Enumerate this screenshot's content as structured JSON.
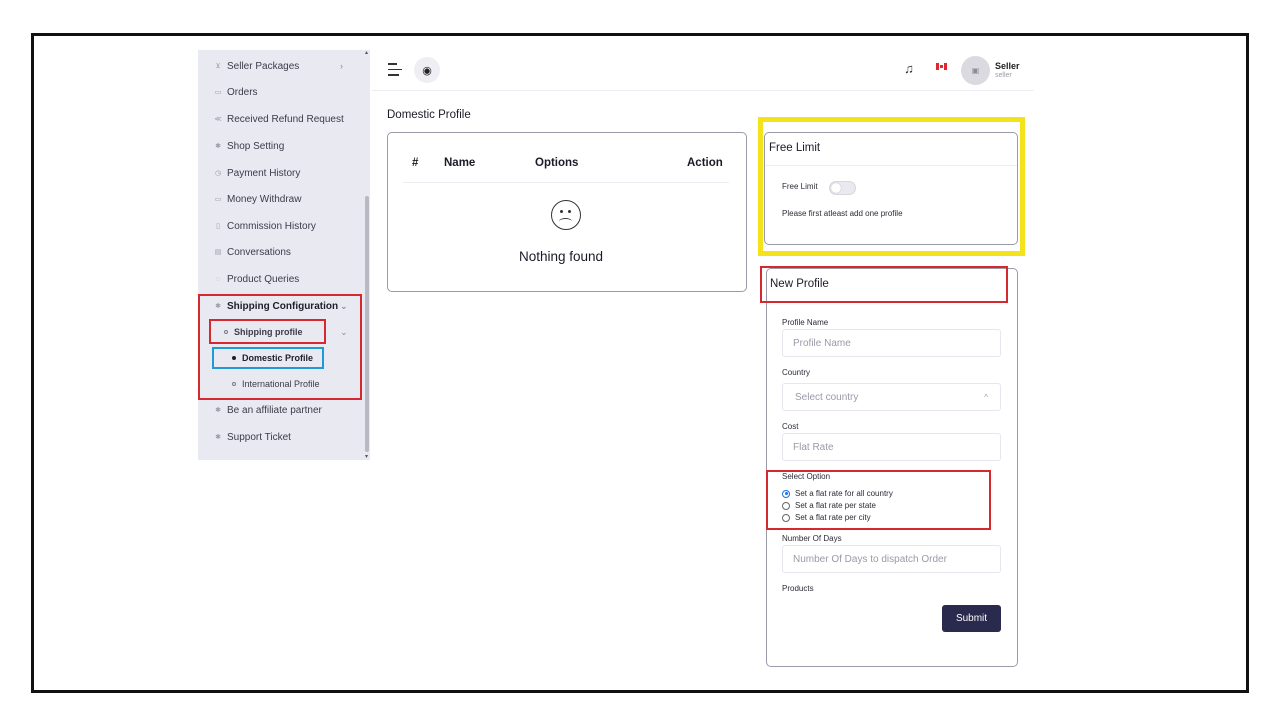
{
  "sidebar": {
    "items": [
      {
        "label": "Seller Packages",
        "icon": "cart-icon"
      },
      {
        "label": "Orders",
        "icon": "orders-icon"
      },
      {
        "label": "Received Refund Request",
        "icon": "refund-icon"
      },
      {
        "label": "Shop Setting",
        "icon": "gear-icon"
      },
      {
        "label": "Payment History",
        "icon": "history-icon"
      },
      {
        "label": "Money Withdraw",
        "icon": "wallet-icon"
      },
      {
        "label": "Commission History",
        "icon": "file-icon"
      },
      {
        "label": "Conversations",
        "icon": "chat-icon"
      },
      {
        "label": "Product Queries",
        "icon": "question-icon"
      },
      {
        "label": "Shipping Configuration",
        "icon": "gear-icon"
      },
      {
        "label": "Be an affiliate partner",
        "icon": "gear-icon"
      },
      {
        "label": "Support Ticket",
        "icon": "gear-icon"
      }
    ],
    "shipping_profile": "Shipping profile",
    "sub_items": [
      "Domestic Profile",
      "International Profile"
    ]
  },
  "header": {
    "user_name": "Seller",
    "user_role": "seller"
  },
  "main": {
    "title": "Domestic Profile",
    "table": {
      "columns": [
        "#",
        "Name",
        "Options",
        "Action"
      ],
      "empty_text": "Nothing found"
    }
  },
  "free_limit": {
    "title": "Free Limit",
    "toggle_label": "Free Limit",
    "note": "Please first atleast add one profile",
    "enabled": false
  },
  "new_profile": {
    "title": "New Profile",
    "profile_name_label": "Profile Name",
    "profile_name_placeholder": "Profile Name",
    "country_label": "Country",
    "country_placeholder": "Select country",
    "cost_label": "Cost",
    "cost_placeholder": "Flat Rate",
    "select_option_label": "Select Option",
    "options": [
      "Set a flat rate for all country",
      "Set a flat rate per state",
      "Set a flat rate per city"
    ],
    "selected_option": 0,
    "days_label": "Number Of Days",
    "days_placeholder": "Number Of Days to dispatch Order",
    "products_label": "Products",
    "submit_label": "Submit"
  },
  "colors": {
    "sidebar_bg": "#e9e9f2",
    "primary_button": "#2a2a4e",
    "highlight_red": "#d6282f",
    "highlight_blue": "#1f9ad6",
    "highlight_yellow": "#f4e21b"
  }
}
